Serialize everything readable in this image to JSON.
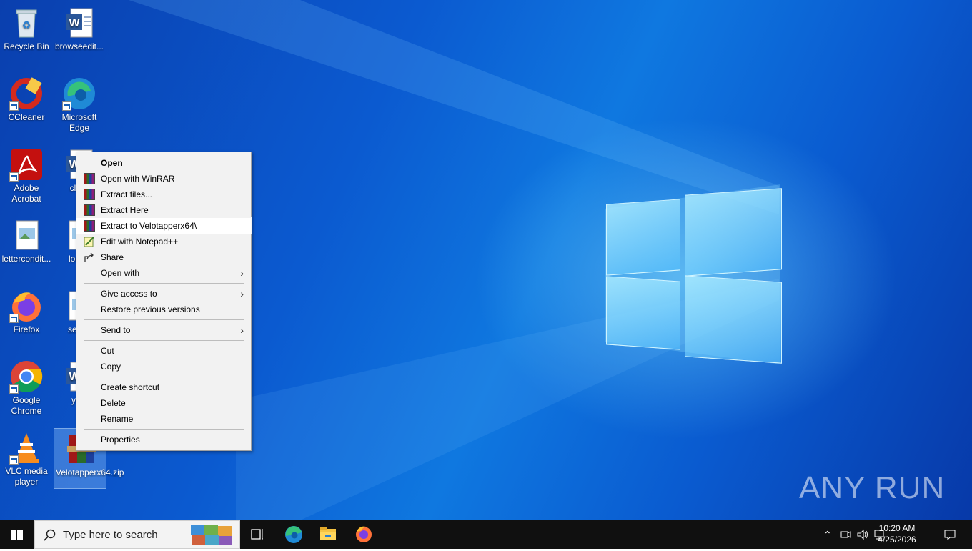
{
  "desktop": {
    "icons": [
      {
        "label": "Recycle Bin"
      },
      {
        "label": "browseedit..."
      },
      {
        "label": "CCleaner"
      },
      {
        "label": "Microsoft Edge"
      },
      {
        "label": "Adobe Acrobat"
      },
      {
        "label": "clinic"
      },
      {
        "label": "lettercondit..."
      },
      {
        "label": "lordta"
      },
      {
        "label": "Firefox"
      },
      {
        "label": "seesh"
      },
      {
        "label": "Google Chrome"
      },
      {
        "label": "youi"
      },
      {
        "label": "VLC media player"
      },
      {
        "label": "Velotapperx64.zip"
      }
    ]
  },
  "context_menu": {
    "items": [
      {
        "label": "Open"
      },
      {
        "label": "Open with WinRAR"
      },
      {
        "label": "Extract files..."
      },
      {
        "label": "Extract Here"
      },
      {
        "label": "Extract to Velotapperx64\\"
      },
      {
        "label": "Edit with Notepad++"
      },
      {
        "label": "Share"
      },
      {
        "label": "Open with"
      },
      {
        "label": "Give access to"
      },
      {
        "label": "Restore previous versions"
      },
      {
        "label": "Send to"
      },
      {
        "label": "Cut"
      },
      {
        "label": "Copy"
      },
      {
        "label": "Create shortcut"
      },
      {
        "label": "Delete"
      },
      {
        "label": "Rename"
      },
      {
        "label": "Properties"
      }
    ]
  },
  "taskbar": {
    "search_placeholder": "Type here to search",
    "time": "10:20 AM",
    "date": "4/25/2026"
  },
  "watermark": "ANY RUN"
}
